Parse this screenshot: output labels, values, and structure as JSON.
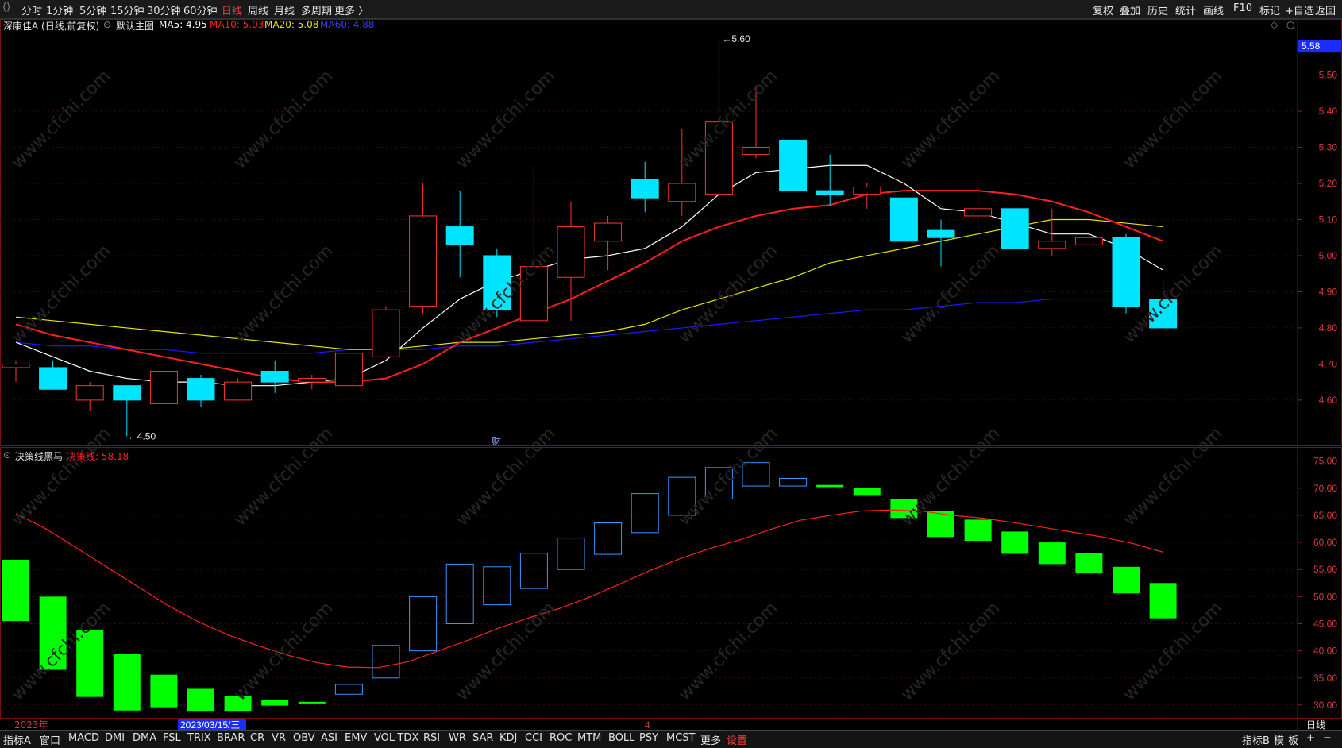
{
  "toolbar": {
    "periods": [
      "分时",
      "1分钟",
      "5分钟",
      "15分钟",
      "30分钟",
      "60分钟",
      "日线",
      "周线",
      "月线",
      "多周期",
      "更多 〉"
    ],
    "active_period": "日线",
    "right_items": [
      "复权",
      "叠加",
      "历史",
      "统计",
      "画线",
      "F10",
      "标记",
      "+自选",
      "返回"
    ]
  },
  "main_pane": {
    "stock_title": "深康佳A (日线,前复权)",
    "theme_label": "默认主图",
    "ma5_label": "MA5: 4.95",
    "ma10_label": "MA10: 5.03",
    "ma20_label": "MA20: 5.08",
    "ma60_label": "MA60: 4.88",
    "current_price": "5.58",
    "high_label": "5.60",
    "low_label": "4.50",
    "finance_mark": "财",
    "y_ticks": [
      "5.50",
      "5.40",
      "5.30",
      "5.20",
      "5.10",
      "5.00",
      "4.90",
      "4.80",
      "4.70",
      "4.60"
    ]
  },
  "indicator_pane": {
    "name": "决策线黑马",
    "line_label": "决策线: 58.18",
    "y_ticks": [
      "75.00",
      "70.00",
      "65.00",
      "60.00",
      "55.00",
      "50.00",
      "45.00",
      "40.00",
      "35.00",
      "30.00"
    ]
  },
  "time_axis": {
    "year_label": "2023年",
    "cursor_date": "2023/03/15/三",
    "month_label": "4",
    "period_label": "日线"
  },
  "watermark": "www.cfchi.com",
  "colors": {
    "up": "#ff3333",
    "down": "#00e5ff",
    "ma5": "#ffffff",
    "ma10": "#ff2020",
    "ma20": "#e5e500",
    "ma60": "#1a1aff",
    "ind_up": "#3c96ff",
    "ind_down": "#00ff00",
    "ind_line": "#ff2020"
  },
  "chart_data": {
    "type": "candlestick",
    "candles": [
      {
        "o": 4.69,
        "h": 4.71,
        "l": 4.65,
        "c": 4.7
      },
      {
        "o": 4.69,
        "h": 4.71,
        "l": 4.63,
        "c": 4.63
      },
      {
        "o": 4.6,
        "h": 4.65,
        "l": 4.57,
        "c": 4.64
      },
      {
        "o": 4.64,
        "h": 4.64,
        "l": 4.5,
        "c": 4.6
      },
      {
        "o": 4.59,
        "h": 4.68,
        "l": 4.59,
        "c": 4.68
      },
      {
        "o": 4.66,
        "h": 4.67,
        "l": 4.58,
        "c": 4.6
      },
      {
        "o": 4.6,
        "h": 4.66,
        "l": 4.6,
        "c": 4.65
      },
      {
        "o": 4.68,
        "h": 4.71,
        "l": 4.62,
        "c": 4.65
      },
      {
        "o": 4.65,
        "h": 4.67,
        "l": 4.63,
        "c": 4.66
      },
      {
        "o": 4.64,
        "h": 4.74,
        "l": 4.64,
        "c": 4.73
      },
      {
        "o": 4.72,
        "h": 4.86,
        "l": 4.72,
        "c": 4.85
      },
      {
        "o": 4.86,
        "h": 5.2,
        "l": 4.84,
        "c": 5.11
      },
      {
        "o": 5.08,
        "h": 5.18,
        "l": 4.94,
        "c": 5.03
      },
      {
        "o": 5.0,
        "h": 5.02,
        "l": 4.83,
        "c": 4.85
      },
      {
        "o": 4.82,
        "h": 5.25,
        "l": 4.82,
        "c": 4.97
      },
      {
        "o": 4.94,
        "h": 5.15,
        "l": 4.82,
        "c": 5.08
      },
      {
        "o": 5.04,
        "h": 5.11,
        "l": 4.96,
        "c": 5.09
      },
      {
        "o": 5.21,
        "h": 5.26,
        "l": 5.12,
        "c": 5.16
      },
      {
        "o": 5.15,
        "h": 5.35,
        "l": 5.11,
        "c": 5.2
      },
      {
        "o": 5.17,
        "h": 5.6,
        "l": 5.17,
        "c": 5.37
      },
      {
        "o": 5.28,
        "h": 5.47,
        "l": 5.27,
        "c": 5.3
      },
      {
        "o": 5.32,
        "h": 5.32,
        "l": 5.18,
        "c": 5.18
      },
      {
        "o": 5.18,
        "h": 5.28,
        "l": 5.14,
        "c": 5.17
      },
      {
        "o": 5.17,
        "h": 5.2,
        "l": 5.13,
        "c": 5.19
      },
      {
        "o": 5.16,
        "h": 5.16,
        "l": 5.04,
        "c": 5.04
      },
      {
        "o": 5.07,
        "h": 5.1,
        "l": 4.97,
        "c": 5.05
      },
      {
        "o": 5.11,
        "h": 5.2,
        "l": 5.07,
        "c": 5.13
      },
      {
        "o": 5.13,
        "h": 5.13,
        "l": 5.02,
        "c": 5.02
      },
      {
        "o": 5.02,
        "h": 5.13,
        "l": 5.0,
        "c": 5.04
      },
      {
        "o": 5.03,
        "h": 5.07,
        "l": 5.02,
        "c": 5.05
      },
      {
        "o": 5.05,
        "h": 5.06,
        "l": 4.84,
        "c": 4.86
      },
      {
        "o": 4.88,
        "h": 4.93,
        "l": 4.8,
        "c": 4.8
      }
    ],
    "ma5": [
      4.76,
      4.72,
      4.68,
      4.66,
      4.65,
      4.65,
      4.64,
      4.64,
      4.65,
      4.66,
      4.71,
      4.8,
      4.88,
      4.93,
      4.96,
      4.99,
      5.0,
      5.02,
      5.08,
      5.17,
      5.23,
      5.24,
      5.25,
      5.25,
      5.2,
      5.13,
      5.12,
      5.09,
      5.06,
      5.06,
      5.02,
      4.96
    ],
    "ma10": [
      4.81,
      4.78,
      4.76,
      4.74,
      4.72,
      4.7,
      4.68,
      4.66,
      4.65,
      4.65,
      4.66,
      4.7,
      4.76,
      4.8,
      4.84,
      4.88,
      4.93,
      4.98,
      5.04,
      5.08,
      5.11,
      5.13,
      5.14,
      5.17,
      5.18,
      5.18,
      5.18,
      5.17,
      5.15,
      5.12,
      5.08,
      5.04
    ],
    "ma20": [
      4.83,
      4.82,
      4.81,
      4.8,
      4.79,
      4.78,
      4.77,
      4.76,
      4.75,
      4.74,
      4.74,
      4.75,
      4.76,
      4.76,
      4.77,
      4.78,
      4.79,
      4.81,
      4.85,
      4.88,
      4.91,
      4.94,
      4.98,
      5.0,
      5.02,
      5.04,
      5.06,
      5.08,
      5.1,
      5.1,
      5.09,
      5.08
    ],
    "ma60": [
      4.76,
      4.75,
      4.75,
      4.74,
      4.74,
      4.73,
      4.73,
      4.73,
      4.73,
      4.74,
      4.74,
      4.74,
      4.75,
      4.75,
      4.76,
      4.77,
      4.78,
      4.79,
      4.8,
      4.81,
      4.82,
      4.83,
      4.84,
      4.85,
      4.85,
      4.86,
      4.87,
      4.87,
      4.88,
      4.88,
      4.88
    ],
    "ylim": [
      4.47,
      5.62
    ],
    "indicator": {
      "boxes": [
        {
          "top": 56.8,
          "bot": 45.5,
          "up": false
        },
        {
          "top": 50.0,
          "bot": 36.5,
          "up": false
        },
        {
          "top": 43.8,
          "bot": 31.5,
          "up": false
        },
        {
          "top": 39.5,
          "bot": 29.0,
          "up": false
        },
        {
          "top": 35.6,
          "bot": 29.6,
          "up": false
        },
        {
          "top": 33.0,
          "bot": 28.8,
          "up": false
        },
        {
          "top": 31.7,
          "bot": 28.8,
          "up": false
        },
        {
          "top": 31.0,
          "bot": 29.9,
          "up": false
        },
        {
          "top": 30.6,
          "bot": 30.3,
          "up": false
        },
        {
          "top": 33.8,
          "bot": 32.0,
          "up": true
        },
        {
          "top": 41.0,
          "bot": 35.0,
          "up": true
        },
        {
          "top": 50.0,
          "bot": 40.0,
          "up": true
        },
        {
          "top": 56.0,
          "bot": 45.0,
          "up": true
        },
        {
          "top": 55.5,
          "bot": 48.5,
          "up": true
        },
        {
          "top": 58.0,
          "bot": 51.5,
          "up": true
        },
        {
          "top": 60.8,
          "bot": 55.0,
          "up": true
        },
        {
          "top": 63.6,
          "bot": 57.8,
          "up": true
        },
        {
          "top": 69.0,
          "bot": 61.8,
          "up": true
        },
        {
          "top": 72.0,
          "bot": 65.0,
          "up": true
        },
        {
          "top": 73.8,
          "bot": 68.0,
          "up": true
        },
        {
          "top": 74.7,
          "bot": 70.4,
          "up": true
        },
        {
          "top": 71.8,
          "bot": 70.4,
          "up": true
        },
        {
          "top": 70.6,
          "bot": 70.2,
          "up": false
        },
        {
          "top": 70.0,
          "bot": 68.6,
          "up": false
        },
        {
          "top": 68.0,
          "bot": 64.5,
          "up": false
        },
        {
          "top": 65.8,
          "bot": 61.0,
          "up": false
        },
        {
          "top": 64.2,
          "bot": 60.3,
          "up": false
        },
        {
          "top": 62.0,
          "bot": 57.9,
          "up": false
        },
        {
          "top": 60.0,
          "bot": 56.0,
          "up": false
        },
        {
          "top": 58.0,
          "bot": 54.4,
          "up": false
        },
        {
          "top": 55.5,
          "bot": 50.6,
          "up": false
        },
        {
          "top": 52.5,
          "bot": 46.0,
          "up": false
        }
      ],
      "line": [
        65.3,
        62.5,
        59.0,
        55.5,
        52.0,
        48.5,
        45.5,
        43.0,
        41.0,
        39.2,
        37.8,
        37.0,
        36.9,
        38.0,
        40.0,
        42.0,
        44.2,
        46.1,
        47.8,
        49.9,
        52.3,
        54.8,
        57.0,
        58.9,
        60.5,
        62.4,
        64.1,
        65.0,
        65.8,
        66.0,
        65.8,
        65.0,
        64.5,
        63.7,
        62.8,
        61.9,
        61.0,
        59.8,
        58.2
      ]
    },
    "ind_ylim": [
      27.5,
      77.0
    ]
  },
  "indicator_tabs": [
    "指标A",
    "窗口",
    "MACD",
    "DMI",
    "DMA",
    "FSL",
    "TRIX",
    "BRAR",
    "CR",
    "VR",
    "OBV",
    "ASI",
    "EMV",
    "VOL-TDX",
    "RSI",
    "WR",
    "SAR",
    "KDJ",
    "CCI",
    "ROC",
    "MTM",
    "BOLL",
    "PSY",
    "MCST",
    "更多",
    "设置"
  ],
  "active_tab": "设置",
  "bottom_right": [
    "指标B",
    "模",
    "板",
    "+",
    "−"
  ]
}
